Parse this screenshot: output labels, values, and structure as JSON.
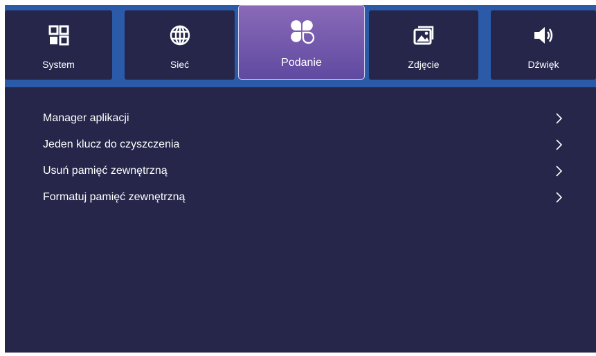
{
  "tabs": [
    {
      "label": "System",
      "icon": "grid-icon"
    },
    {
      "label": "Sieć",
      "icon": "globe-icon"
    },
    {
      "label": "Podanie",
      "icon": "apps-icon",
      "selected": true
    },
    {
      "label": "Zdjęcie",
      "icon": "image-icon"
    },
    {
      "label": "Dźwięk",
      "icon": "speaker-icon"
    }
  ],
  "menu": {
    "items": [
      {
        "label": "Manager aplikacji"
      },
      {
        "label": "Jeden klucz do czyszczenia"
      },
      {
        "label": "Usuń pamięć zewnętrzną"
      },
      {
        "label": "Formatuj pamięć zewnętrzną"
      }
    ]
  },
  "colors": {
    "background": "#25264a",
    "topbar": "#2a5aa8",
    "selected_tab": "#7a5cb0",
    "text": "#ffffff"
  }
}
